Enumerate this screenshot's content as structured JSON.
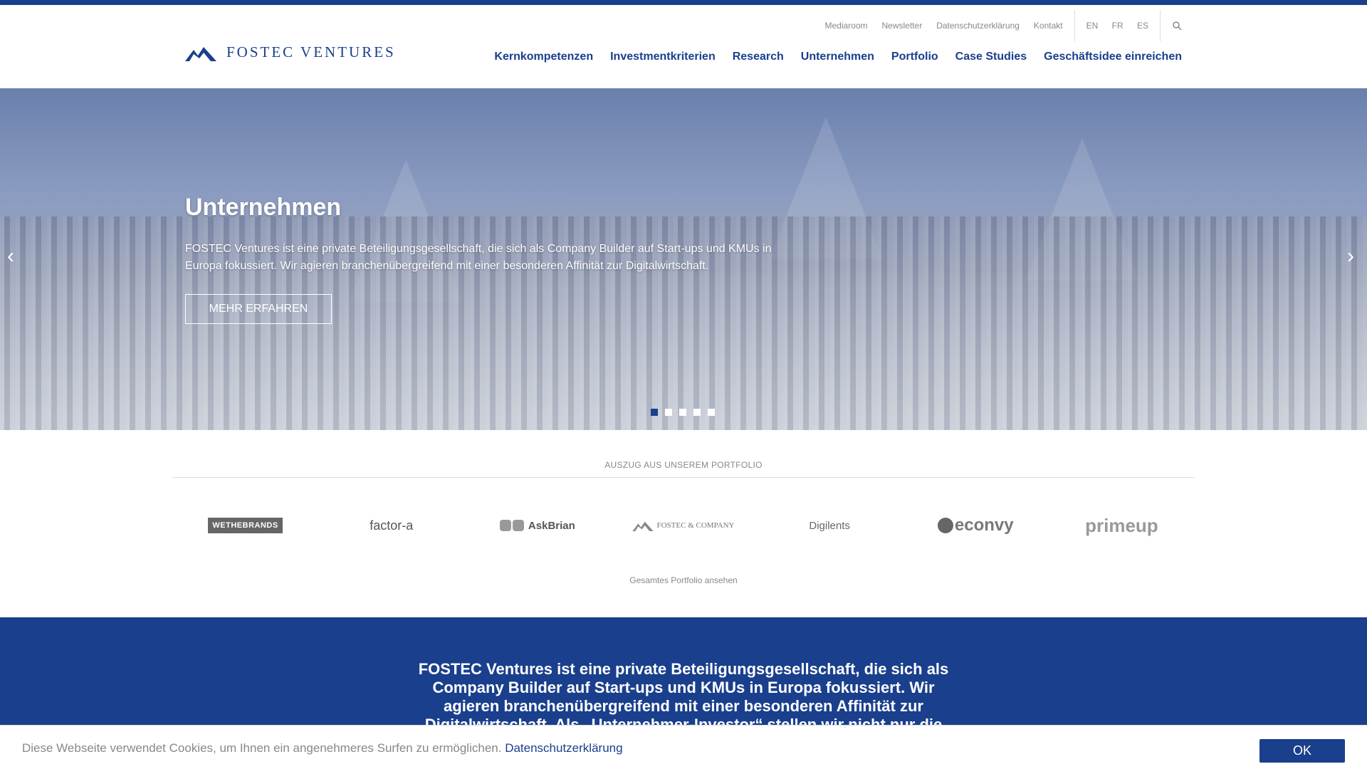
{
  "header": {
    "logo_text": "FOSTEC VENTURES",
    "meta_links": [
      "Mediaroom",
      "Newsletter",
      "Datenschutzerklärung",
      "Kontakt"
    ],
    "languages": [
      "EN",
      "FR",
      "ES"
    ],
    "search_icon": "search-icon",
    "nav": [
      "Kernkompetenzen",
      "Investmentkriterien",
      "Research",
      "Unternehmen",
      "Portfolio",
      "Case Studies",
      "Geschäftsidee einreichen"
    ]
  },
  "hero": {
    "title": "Unternehmen",
    "text": "FOSTEC Ventures ist eine private Beteiligungsgesellschaft, die sich als Company Builder auf Start-ups und KMUs in Europa fokussiert. Wir agieren branchenübergreifend mit einer besonderen Affinität zur Digitalwirtschaft.",
    "button": "MEHR ERFAHREN",
    "prev_icon": "chevron-left-icon",
    "next_icon": "chevron-right-icon",
    "slides": 5,
    "active_slide": 1
  },
  "portfolio": {
    "heading": "AUSZUG AUS UNSEREM PORTFOLIO",
    "logos": [
      "WETHEBRANDS",
      "factor-a",
      "AskBrian",
      "FOSTEC & COMPANY",
      "Digilents",
      "econvy",
      "primeup"
    ],
    "link": "Gesamtes Portfolio ansehen"
  },
  "about": {
    "text": "FOSTEC Ventures ist eine private Beteiligungsgesellschaft, die sich als Company Builder auf Start-ups und KMUs in Europa fokussiert. Wir agieren branchenübergreifend mit einer besonderen Affinität zur Digitalwirtschaft. Als „Unternehmer-Investor“ stellen wir nicht nur die"
  },
  "cookie": {
    "text": "Diese Webseite verwendet Cookies, um Ihnen ein angenehmeres Surfen zu ermöglichen.",
    "link": "Datenschutzerklärung",
    "button": "OK"
  },
  "colors": {
    "brand": "#1a3f8c"
  }
}
